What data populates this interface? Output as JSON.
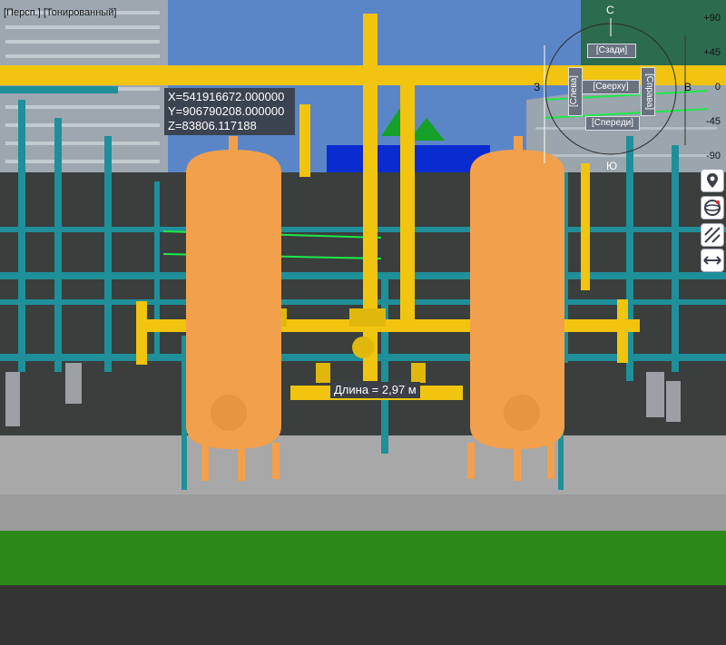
{
  "viewport": {
    "label": "[Персп.] [Тонированный]"
  },
  "coordinates": {
    "x": "X=541916672.000000",
    "y": "Y=906790208.000000",
    "z": "Z=83806.117188"
  },
  "measurement": {
    "label": "Длина = 2,97 м"
  },
  "view_cube": {
    "back": "[Сзади]",
    "top": "[Сверху]",
    "left": "[Слева]",
    "right": "[Справа]",
    "front": "[Спереди]",
    "compass_c": "С",
    "compass_z": "З",
    "compass_v": "В",
    "compass_yu": "Ю"
  },
  "angle_scale": {
    "ticks": [
      "+90",
      "+45",
      "0",
      "-45",
      "-90"
    ]
  },
  "nav_tools": [
    {
      "name": "pin-icon"
    },
    {
      "name": "orbit-icon"
    },
    {
      "name": "section-icon"
    },
    {
      "name": "pan-icon"
    }
  ],
  "colors": {
    "sky": "#5a86c8",
    "vessel": "#f2a04c",
    "pipe_yellow": "#f1c40f",
    "steel_teal": "#1f8f9a",
    "ground_grass": "#2c8a1a",
    "slab": "#a8a8a8"
  }
}
